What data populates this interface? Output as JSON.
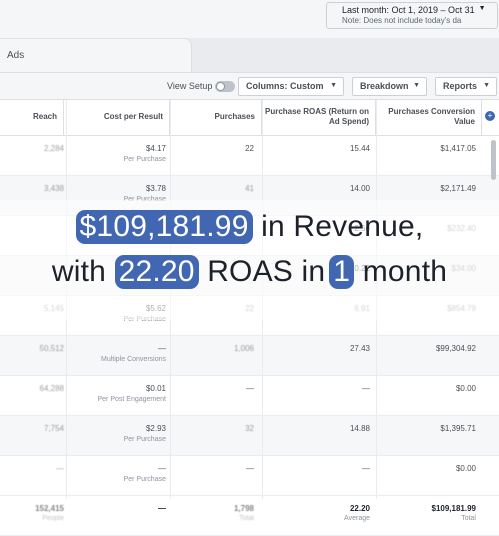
{
  "date_range": {
    "label": "Last month: Oct 1, 2019 – Oct 31",
    "note": "Note: Does not include today's da"
  },
  "tab": {
    "label": "Ads"
  },
  "toolbar": {
    "view_setup": "View Setup",
    "columns": "Columns: Custom",
    "breakdown": "Breakdown",
    "reports": "Reports"
  },
  "table": {
    "headers": [
      "Reach",
      "Cost per Result",
      "Purchases",
      "Purchase ROAS (Return on Ad Spend)",
      "Purchases Conversion Value"
    ],
    "rows": [
      {
        "reach": "2,284",
        "cost": "$4.17",
        "cost_sub": "Per Purchase",
        "purchases": "22",
        "roas": "15.44",
        "value": "$1,417.05"
      },
      {
        "reach": "3,438",
        "cost": "$3.78",
        "cost_sub": "Per Purchase",
        "purchases": "41",
        "roas": "14.00",
        "value": "$2,171.49"
      },
      {
        "reach": "",
        "cost": "",
        "cost_sub": "",
        "purchases": "",
        "roas": "2.50",
        "value": "$232.40"
      },
      {
        "reach": "",
        "cost": "",
        "cost_sub": "",
        "purchases": "",
        "roas": "0.22",
        "value": "$34.00"
      },
      {
        "reach": "5,145",
        "cost": "$5.62",
        "cost_sub": "Per Purchase",
        "purchases": "22",
        "roas": "6.91",
        "value": "$854.79"
      },
      {
        "reach": "50,512",
        "cost": "—",
        "cost_sub": "Multiple Conversions",
        "purchases": "1,006",
        "roas": "27.43",
        "value": "$99,304.92"
      },
      {
        "reach": "64,288",
        "cost": "$0.01",
        "cost_sub": "Per Post Engagement",
        "purchases": "—",
        "roas": "—",
        "value": "$0.00"
      },
      {
        "reach": "7,754",
        "cost": "$2.93",
        "cost_sub": "Per Purchase",
        "purchases": "32",
        "roas": "14.88",
        "value": "$1,395.71"
      },
      {
        "reach": "—",
        "cost": "—",
        "cost_sub": "Per Purchase",
        "purchases": "—",
        "roas": "—",
        "value": "$0.00"
      }
    ],
    "totals": {
      "reach": "152,415",
      "reach_sub": "People",
      "cost": "—",
      "purchases": "1,798",
      "purchases_sub": "Total",
      "roas": "22.20",
      "roas_sub": "Average",
      "value": "$109,181.99",
      "value_sub": "Total"
    }
  },
  "headline": {
    "revenue": "$109,181.99",
    "revenue_suffix": "in Revenue,",
    "prefix": "with",
    "roas": "22.20",
    "roas_text": "ROAS in",
    "months": "1",
    "month_word": "month"
  },
  "colors": {
    "accent": "#4267b2",
    "text": "#1d2129"
  }
}
